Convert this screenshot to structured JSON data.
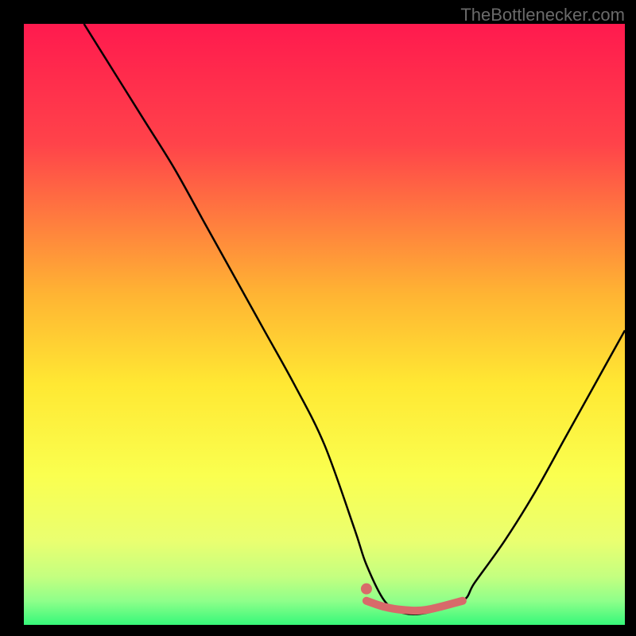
{
  "watermark": "TheBottlenecker.com",
  "chart_data": {
    "type": "line",
    "title": "",
    "xlabel": "",
    "ylabel": "",
    "xlim": [
      0,
      100
    ],
    "ylim": [
      0,
      100
    ],
    "series": [
      {
        "name": "curve",
        "x": [
          10,
          15,
          20,
          25,
          30,
          35,
          40,
          45,
          50,
          55,
          57,
          60,
          63,
          67,
          73,
          75,
          80,
          85,
          90,
          95,
          100
        ],
        "y": [
          100,
          92,
          84,
          76,
          67,
          58,
          49,
          40,
          30,
          16,
          10,
          4,
          2,
          2,
          4,
          7,
          14,
          22,
          31,
          40,
          49
        ]
      },
      {
        "name": "highlight-segment",
        "x": [
          57,
          60,
          63,
          67,
          73
        ],
        "y": [
          4,
          3,
          2.5,
          2.5,
          4
        ]
      },
      {
        "name": "highlight-point",
        "x": [
          57
        ],
        "y": [
          6
        ]
      }
    ],
    "background_gradient": {
      "stops": [
        {
          "offset": 0,
          "color": "#ff1a4e"
        },
        {
          "offset": 20,
          "color": "#ff434a"
        },
        {
          "offset": 45,
          "color": "#ffb433"
        },
        {
          "offset": 60,
          "color": "#ffe833"
        },
        {
          "offset": 75,
          "color": "#faff4f"
        },
        {
          "offset": 86,
          "color": "#eaff70"
        },
        {
          "offset": 92,
          "color": "#c4ff80"
        },
        {
          "offset": 96,
          "color": "#8fff8a"
        },
        {
          "offset": 100,
          "color": "#36f87a"
        }
      ]
    },
    "highlight_color": "#d86a6a",
    "curve_color": "#000000"
  }
}
